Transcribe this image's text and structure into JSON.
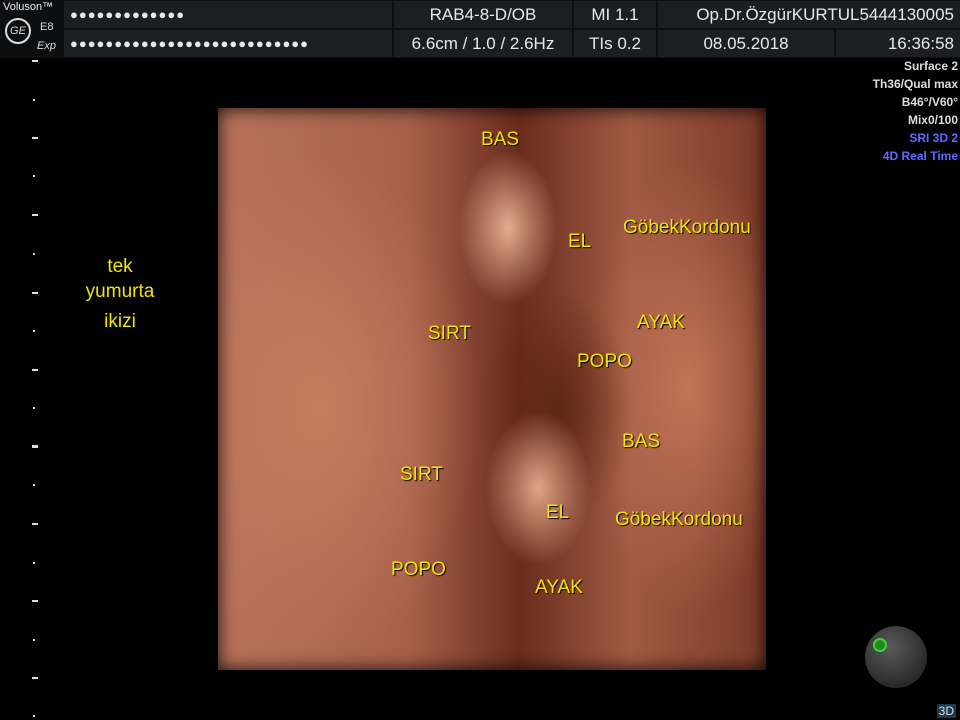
{
  "header": {
    "brand": "Voluson™",
    "logo": "GE",
    "model": "E8",
    "mode": "Exp",
    "patient_name": "●●●●●●●●●●●●●",
    "patient_id": "●●●●●●●●●●●●●●●●●●●●●●●●●●●",
    "probe": "RAB4-8-D/OB",
    "mi": "MI  1.1",
    "operator": "Op.Dr.ÖzgürKURTUL5444130005",
    "depth_freq": "6.6cm / 1.0 / 2.6Hz",
    "tis": "TIs  0.2",
    "date": "08.05.2018",
    "time": "16:36:58"
  },
  "side_label": {
    "line1": "tek",
    "line2": "yumurta",
    "line3": "ikizi"
  },
  "params": {
    "surface": "Surface 2",
    "threshold": "Th36/Qual max",
    "angle": "B46°/V60°",
    "mix": "Mix0/100",
    "sri": "SRI 3D 2",
    "realtime": "4D Real Time"
  },
  "annotations": {
    "bas1": "BAS",
    "el1": "EL",
    "gobek1": "GöbekKordonu",
    "sirt1": "SIRT",
    "ayak1": "AYAK",
    "popo1": "POPO",
    "bas2": "BAS",
    "sirt2": "SIRT",
    "el2": "EL",
    "gobek2": "GöbekKordonu",
    "popo2": "POPO",
    "ayak2": "AYAK"
  },
  "mode_badge": "3D",
  "icons": {
    "logo": "ge-logo-icon",
    "knob": "orientation-knob-icon"
  },
  "colors": {
    "annotation": "#f2e600",
    "param_highlight": "#5f6bff"
  }
}
